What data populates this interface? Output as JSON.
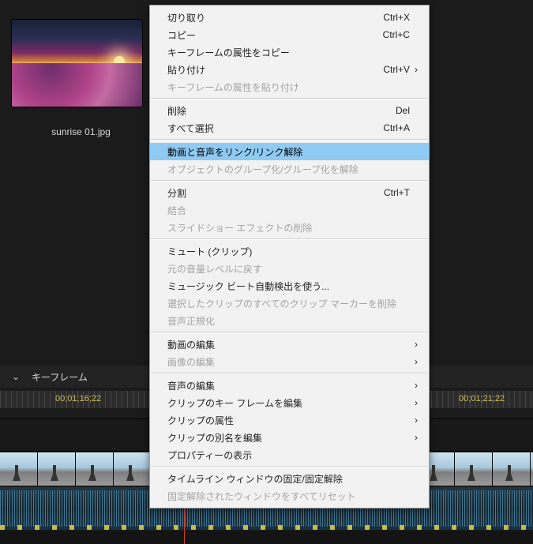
{
  "clip": {
    "filename": "sunrise 01.jpg"
  },
  "timeline": {
    "keyframe_button": "キーフレーム",
    "chevron_glyph": "⌄",
    "timecode_left": "00;01;16;22",
    "timecode_right": "00;01;21;22"
  },
  "menu": {
    "items": [
      {
        "label": "切り取り",
        "shortcut": "Ctrl+X",
        "enabled": true
      },
      {
        "label": "コピー",
        "shortcut": "Ctrl+C",
        "enabled": true
      },
      {
        "label": "キーフレームの属性をコピー",
        "enabled": true
      },
      {
        "label": "貼り付け",
        "shortcut": "Ctrl+V",
        "submenu": true,
        "enabled": true
      },
      {
        "label": "キーフレームの属性を貼り付け",
        "enabled": false
      },
      {
        "sep": true
      },
      {
        "label": "削除",
        "shortcut": "Del",
        "enabled": true
      },
      {
        "label": "すべて選択",
        "shortcut": "Ctrl+A",
        "enabled": true
      },
      {
        "sep": true
      },
      {
        "label": "動画と音声をリンク/リンク解除",
        "enabled": true,
        "highlight": true
      },
      {
        "label": "オブジェクトのグループ化/グループ化を解除",
        "enabled": false
      },
      {
        "sep": true
      },
      {
        "label": "分割",
        "shortcut": "Ctrl+T",
        "enabled": true
      },
      {
        "label": "結合",
        "enabled": false
      },
      {
        "label": "スライドショー エフェクトの削除",
        "enabled": false
      },
      {
        "sep": true
      },
      {
        "label": "ミュート (クリップ)",
        "enabled": true
      },
      {
        "label": "元の音量レベルに戻す",
        "enabled": false
      },
      {
        "label": "ミュージック ビート自動検出を使う...",
        "enabled": true
      },
      {
        "label": "選択したクリップのすべてのクリップ マーカーを削除",
        "enabled": false
      },
      {
        "label": "音声正規化",
        "enabled": false
      },
      {
        "sep": true
      },
      {
        "label": "動画の編集",
        "submenu": true,
        "enabled": true
      },
      {
        "label": "画像の編集",
        "submenu": true,
        "enabled": false
      },
      {
        "sep": true
      },
      {
        "label": "音声の編集",
        "submenu": true,
        "enabled": true
      },
      {
        "label": "クリップのキー フレームを編集",
        "submenu": true,
        "enabled": true
      },
      {
        "label": "クリップの属性",
        "submenu": true,
        "enabled": true
      },
      {
        "label": "クリップの別名を編集",
        "submenu": true,
        "enabled": true
      },
      {
        "label": "プロパティーの表示",
        "enabled": true
      },
      {
        "sep": true
      },
      {
        "label": "タイムライン ウィンドウの固定/固定解除",
        "enabled": true
      },
      {
        "label": "固定解除されたウィンドウをすべてリセット",
        "enabled": false
      }
    ],
    "submenu_glyph": "›"
  }
}
